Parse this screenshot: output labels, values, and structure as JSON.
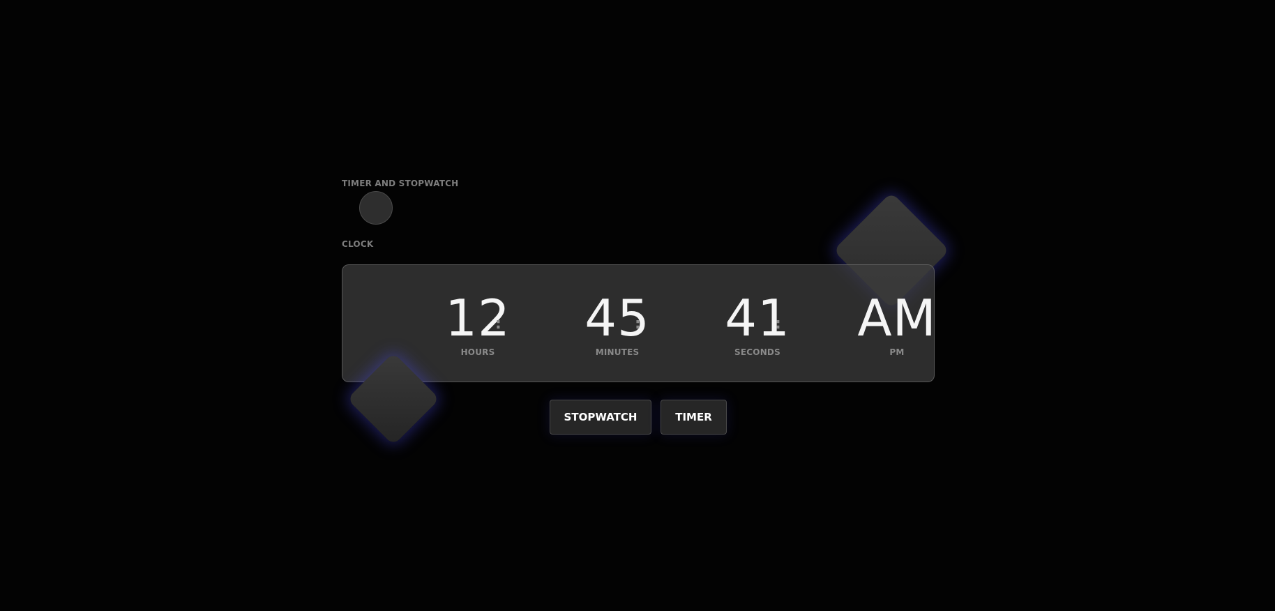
{
  "mode_switch": {
    "top_label": "TIMER AND STOPWATCH",
    "bottom_label": "CLOCK"
  },
  "clock": {
    "hours": {
      "value": "12",
      "caption": "HOURS"
    },
    "minutes": {
      "value": "45",
      "caption": "MINUTES"
    },
    "seconds": {
      "value": "41",
      "caption": "SECONDS"
    },
    "period": {
      "value": "AM",
      "caption": "PM"
    },
    "separator": ":"
  },
  "buttons": {
    "stopwatch_label": "STOPWATCH",
    "timer_label": "TIMER"
  },
  "colors": {
    "background": "#030303",
    "panel": "#3e3e3e",
    "glow": "#5050ff",
    "text": "#f5f5f5",
    "muted_text": "#8a8a8a"
  }
}
